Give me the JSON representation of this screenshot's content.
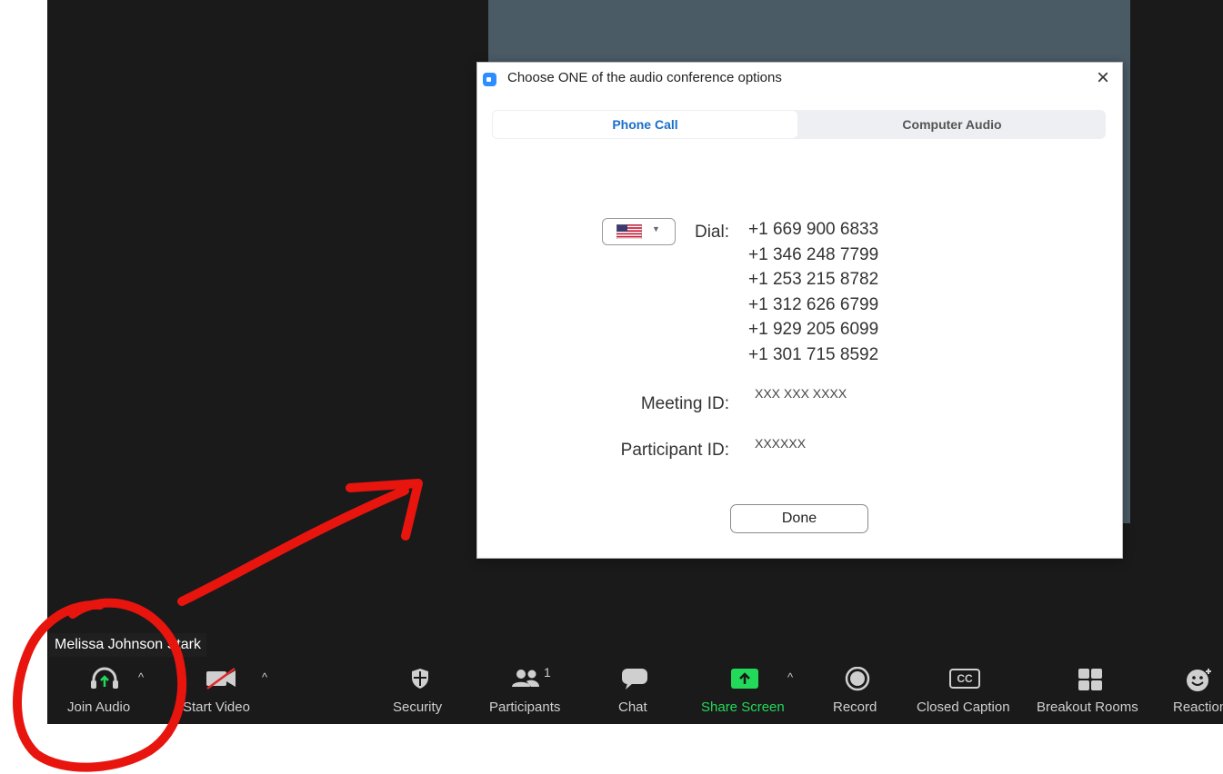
{
  "dialog": {
    "title": "Choose ONE of the audio conference options",
    "close_glyph": "×",
    "tabs": [
      {
        "label": "Phone Call",
        "active": true
      },
      {
        "label": "Computer Audio",
        "active": false
      }
    ],
    "dial_label": "Dial:",
    "country_flag_icon": "us-flag-icon",
    "dial_numbers": [
      "+1 669 900 6833",
      "+1 346 248 7799",
      "+1 253 215 8782",
      "+1 312 626 6799",
      "+1 929 205 6099",
      "+1 301 715 8592"
    ],
    "meeting_id_label": "Meeting ID:",
    "meeting_id_value": "XXX XXX XXXX",
    "participant_id_label": "Participant ID:",
    "participant_id_value": "XXXXXX",
    "done_label": "Done"
  },
  "name_tag": "Melissa Johnson Stark",
  "toolbar": {
    "join_audio": "Join Audio",
    "start_video": "Start Video",
    "security": "Security",
    "participants": "Participants",
    "participants_count": "1",
    "chat": "Chat",
    "share_screen": "Share Screen",
    "record": "Record",
    "closed_caption": "Closed Caption",
    "closed_caption_icon_text": "CC",
    "breakout_rooms": "Breakout Rooms",
    "reactions": "Reactions"
  },
  "colors": {
    "accent_green": "#23d959",
    "tab_active_blue": "#1a6fc9",
    "annotation_red": "#e8140e"
  }
}
